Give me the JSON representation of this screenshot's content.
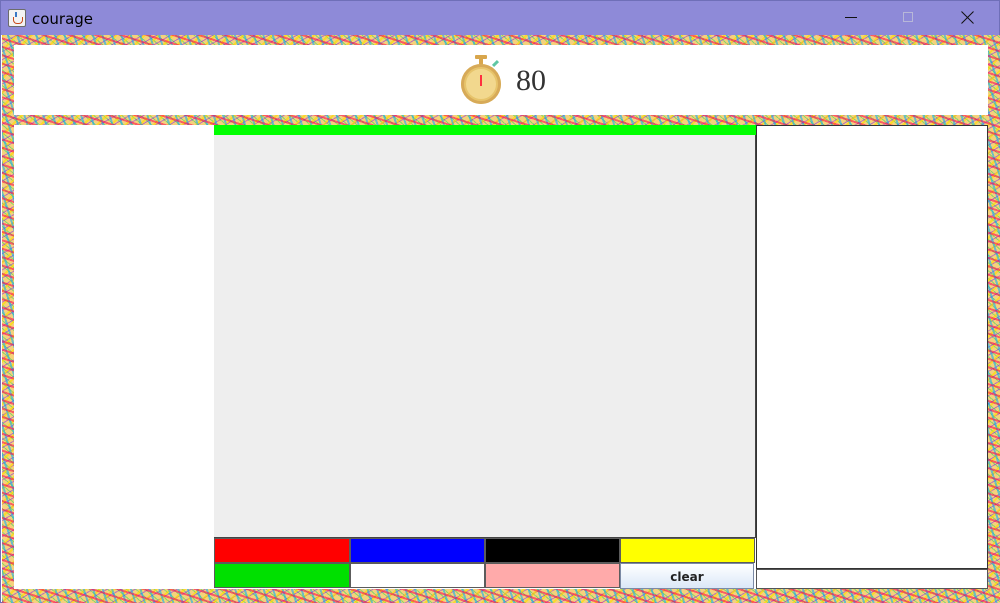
{
  "window": {
    "title": "courage",
    "controls": {
      "minimize": "minimize",
      "maximize": "maximize",
      "close": "close"
    }
  },
  "timer": {
    "value": "80",
    "progress": 1
  },
  "palette": {
    "colors": [
      "#ff0000",
      "#0000ff",
      "#000000",
      "#ffff00",
      "#00e000",
      "#ffffff",
      "#ffaaaa"
    ],
    "clear_label": "clear"
  },
  "input": {
    "value": ""
  }
}
